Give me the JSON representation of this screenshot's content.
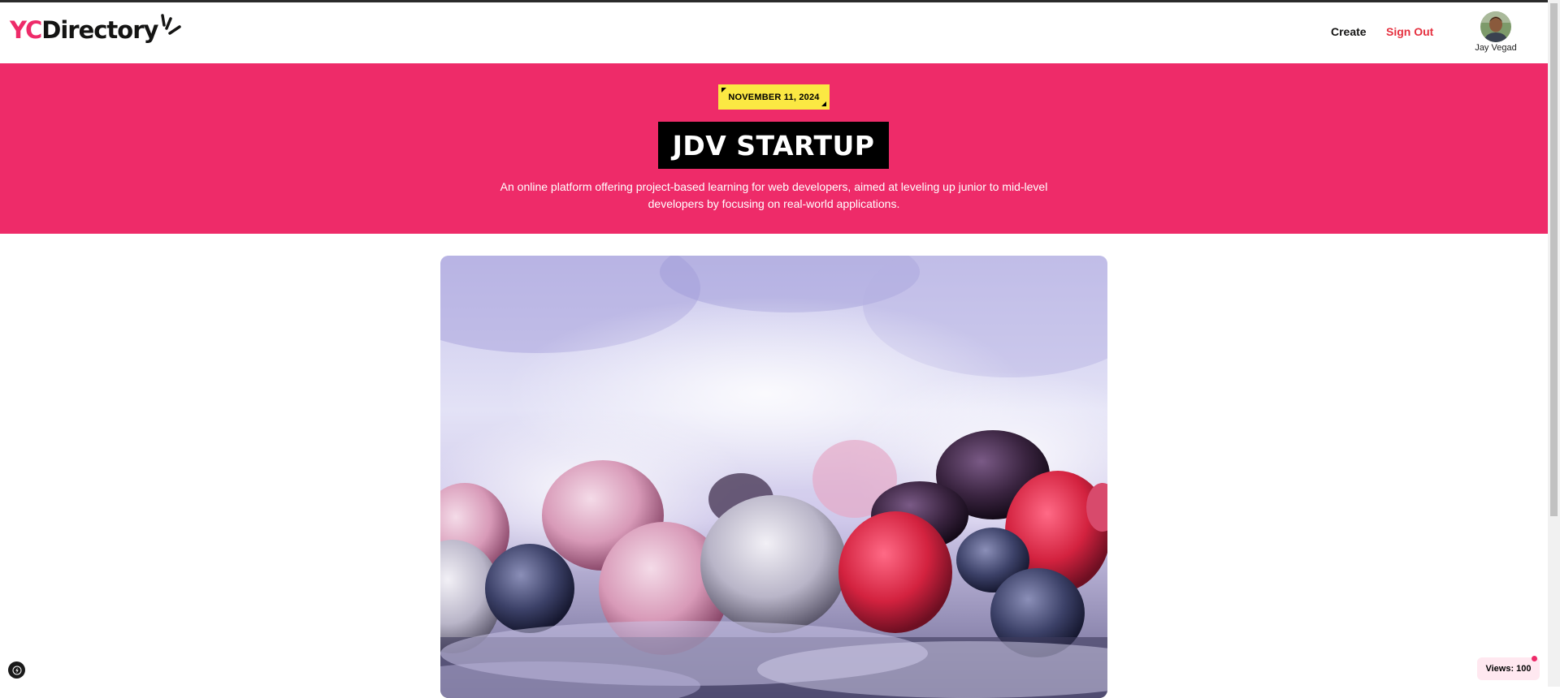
{
  "navbar": {
    "logo_prefix": "YC",
    "logo_text": "Directory",
    "create_label": "Create",
    "signout_label": "Sign Out",
    "user_name": "Jay Vegad"
  },
  "hero": {
    "date": "NOVEMBER 11, 2024",
    "title": "JDV STARTUP",
    "description": "An online platform offering project-based learning for web developers, aimed at leveling up junior to mid-level developers by focusing on real-world applications."
  },
  "views": {
    "label": "Views: 100"
  },
  "colors": {
    "primary_pink": "#ee2b69",
    "tag_yellow": "#fbe843",
    "signout_red": "#e5303f"
  },
  "icons": [
    "logo-rays-icon",
    "avatar",
    "next-dev-icon"
  ]
}
